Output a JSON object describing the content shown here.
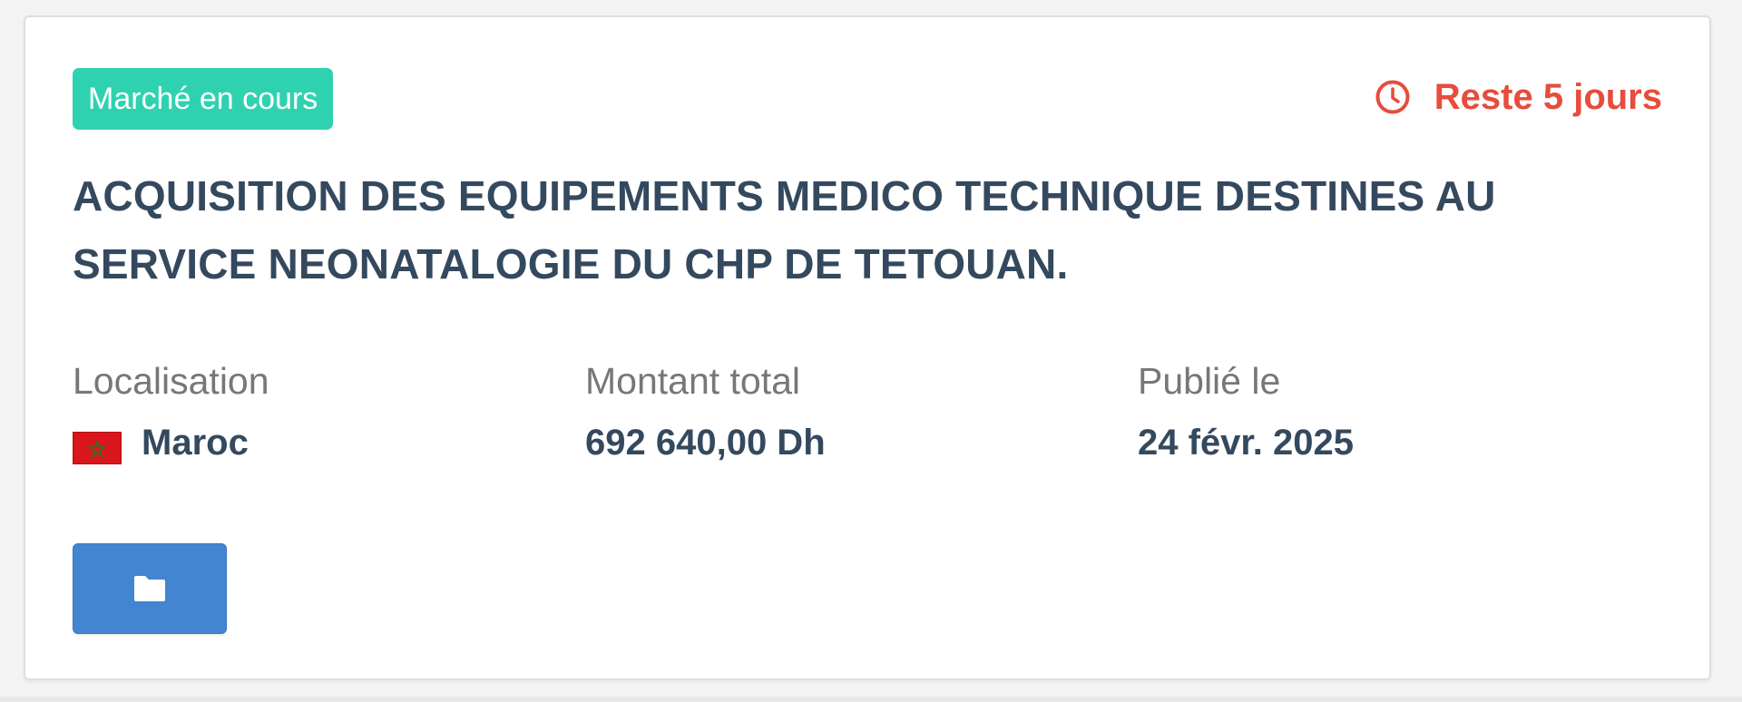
{
  "card": {
    "status_badge": "Marché en cours",
    "countdown": {
      "icon": "clock-icon",
      "text": "Reste 5 jours",
      "color": "#e74c3c"
    },
    "title": "ACQUISITION DES EQUIPEMENTS MEDICO TECHNIQUE DESTINES AU SERVICE NEONATALOGIE DU CHP DE TETOUAN.",
    "details": {
      "location": {
        "label": "Localisation",
        "value": "Maroc",
        "flag_icon": "morocco-flag-icon"
      },
      "amount": {
        "label": "Montant total",
        "value": "692 640,00 Dh"
      },
      "published": {
        "label": "Publié le",
        "value": "24 févr. 2025"
      }
    },
    "action_button": {
      "icon": "folder-icon"
    }
  },
  "colors": {
    "badge_bg": "#2fd2b0",
    "title_text": "#34495e",
    "label_text": "#777777",
    "button_bg": "#4285d0",
    "accent_red": "#e74c3c"
  }
}
